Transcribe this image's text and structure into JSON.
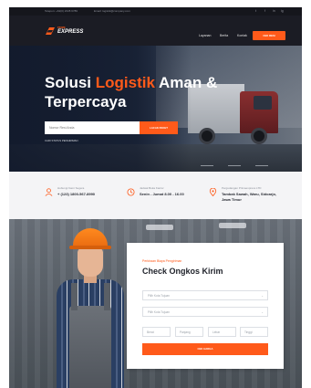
{
  "topbar": {
    "phone": "Telepon: +62(0) 2345 6789",
    "email": "Email: logistik@company.com",
    "social": [
      "t",
      "f",
      "in",
      "ig"
    ]
  },
  "nav": {
    "logo_small": "PRIME",
    "logo_big": "EXPRESS",
    "menu": [
      "Layanan",
      "Berita",
      "Kontak"
    ],
    "cta": "CEK RESI"
  },
  "hero": {
    "title_part1": "Solusi ",
    "title_accent": "Logistik",
    "title_part2": " Aman &",
    "title_line2": "Terpercaya",
    "input_placeholder": "Nomor Resi Anda",
    "button": "LACAK PAKET",
    "link": "CARI STATUS PENGIRIMAN"
  },
  "info": [
    {
      "icon": "user-icon",
      "label": "Hubungi Kami Segera",
      "value": "+ (123) 1800-567-8990"
    },
    {
      "icon": "clock-icon",
      "label": "Jadwal Buka Kantor",
      "value": "Senin - Jumat 8.00 - 16.00"
    },
    {
      "icon": "location-icon",
      "label": "Pergudangan Primaexpress LTD",
      "value": "Tambak Sawah, Waru, Sidoarjo,",
      "value2": "Jawa Timur"
    }
  ],
  "form": {
    "kicker": "Perkiraan Biaya Pengiriman",
    "title": "Check Ongkos Kirim",
    "from_placeholder": "Pilih Kota Tujuan",
    "to_placeholder": "Pilih Kota Tujuan",
    "fields": [
      "Berat",
      "Panjang",
      "Lebar",
      "Tinggi"
    ],
    "button": "CEK HARGA"
  },
  "colors": {
    "accent": "#ff5a1a",
    "dark": "#1b1c24"
  }
}
